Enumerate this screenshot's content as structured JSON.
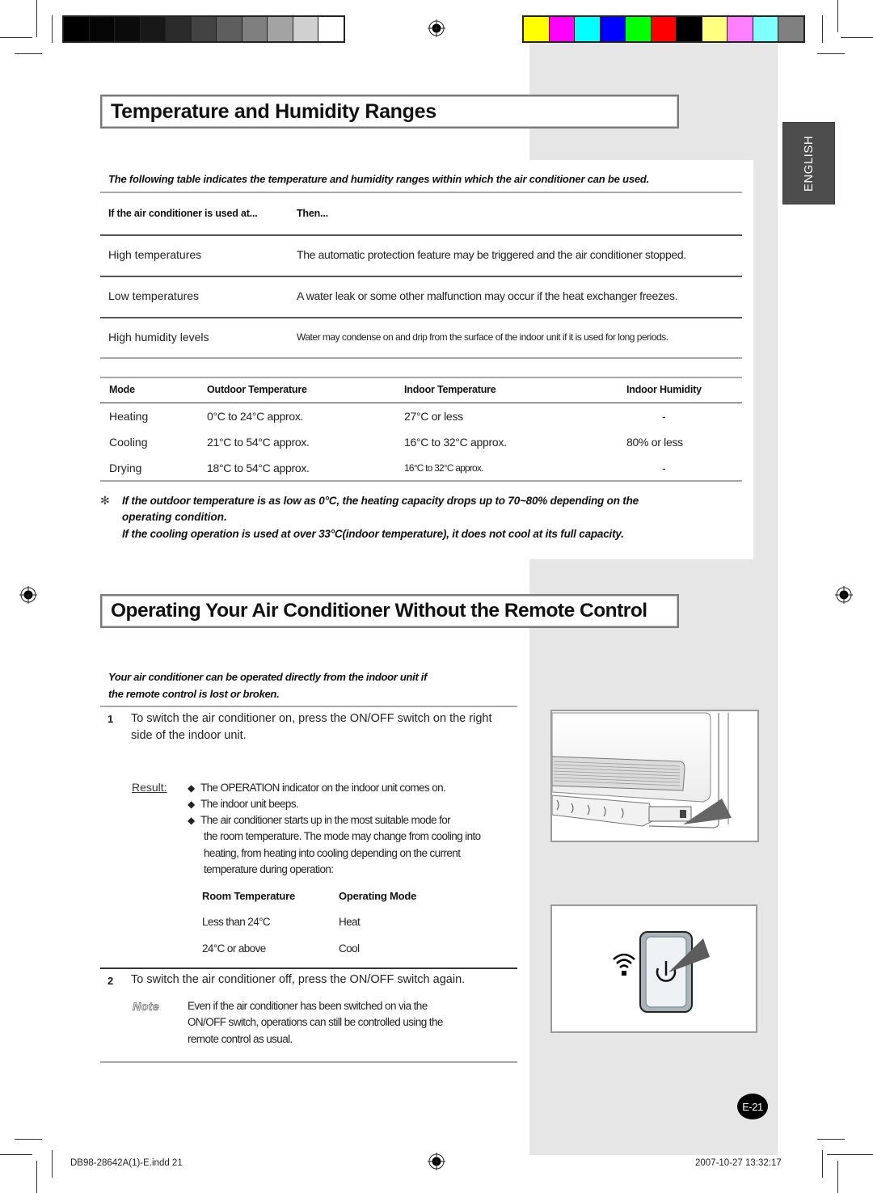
{
  "print_marks": {
    "grayscale_swatches": [
      "#000000",
      "#050505",
      "#0b0b0b",
      "#181818",
      "#2b2b2b",
      "#434343",
      "#5e5e5e",
      "#7f7f7f",
      "#a3a3a3",
      "#d0d0d0",
      "#ffffff"
    ],
    "color_swatches": [
      "#ffff00",
      "#ff00ff",
      "#00ffff",
      "#0000ff",
      "#00ff00",
      "#ff0000",
      "#000000",
      "#ffff80",
      "#ff80ff",
      "#80ffff",
      "#808080"
    ]
  },
  "language_tab": "ENGLISH",
  "section1": {
    "title": "Temperature and Humidity Ranges",
    "intro": "The following table indicates the temperature and humidity ranges within which the air conditioner can be used.",
    "conditions_table": {
      "headers": [
        "If the air conditioner is used at...",
        "Then..."
      ],
      "rows": [
        [
          "High temperatures",
          "The automatic protection feature may be triggered and the air conditioner stopped."
        ],
        [
          "Low temperatures",
          "A water leak or some other malfunction may occur if the heat exchanger freezes."
        ],
        [
          "High humidity levels",
          "Water may condense on and drip from the surface of the indoor unit if it is used for long periods."
        ]
      ]
    },
    "ranges_table": {
      "headers": [
        "Mode",
        "Outdoor Temperature",
        "Indoor Temperature",
        "Indoor Humidity"
      ],
      "rows": [
        [
          "Heating",
          "0°C to 24°C approx.",
          "27°C or less",
          "-"
        ],
        [
          "Cooling",
          "21°C to 54°C approx.",
          "16°C to 32°C approx.",
          "80% or less"
        ],
        [
          "Drying",
          "18°C to 54°C approx.",
          "16°C to 32°C approx.",
          "-"
        ]
      ]
    },
    "footnote_symbol": "✻",
    "footnote_lines": [
      "If the outdoor temperature is as low as 0°C, the heating capacity drops up to 70~80% depending on the",
      "operating condition.",
      "If the cooling operation is used at over 33°C(indoor temperature), it does not cool at its full capacity."
    ]
  },
  "section2": {
    "title": "Operating Your Air Conditioner Without the Remote Control",
    "intro_lines": [
      "Your air conditioner can be operated directly from the indoor unit if",
      "the remote control is lost or broken."
    ],
    "step1": {
      "number": "1",
      "lines": [
        "To switch the air conditioner on, press the ON/OFF switch on the right",
        "side of the indoor unit."
      ],
      "result_label": "Result:",
      "bullet_symbol": "◆",
      "bullets": [
        "The OPERATION indicator on the indoor unit comes on.",
        "The indoor unit beeps.",
        "The air conditioner starts up in the most suitable mode for"
      ],
      "bullet3_continuation": [
        "the room temperature. The mode may change from cooling into",
        "heating, from heating into cooling depending on the current",
        "temperature during operation:"
      ],
      "mode_table": {
        "headers": [
          "Room Temperature",
          "Operating Mode"
        ],
        "rows": [
          [
            "Less than 24°C",
            "Heat"
          ],
          [
            "24°C or above",
            "Cool"
          ]
        ]
      }
    },
    "step2": {
      "number": "2",
      "text": "To switch the air conditioner off, press the ON/OFF switch again.",
      "note_label": "Note",
      "note_lines": [
        "Even if the air conditioner has been switched on via the",
        "ON/OFF switch, operations can still be controlled using the",
        "remote control as usual."
      ]
    }
  },
  "page_badge": "E-21",
  "footer": {
    "file": "DB98-28642A(1)-E.indd   21",
    "timestamp": "2007-10-27   13:32:17"
  }
}
